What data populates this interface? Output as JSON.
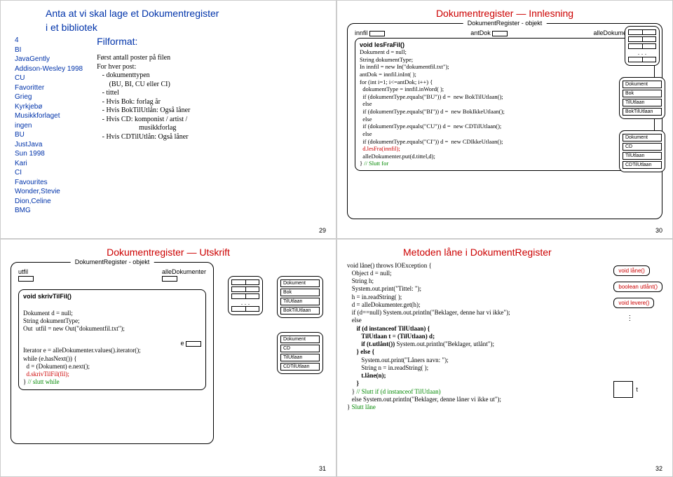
{
  "s29": {
    "title1": "Anta at vi skal lage et Dokumentregister",
    "title2": "i et bibliotek",
    "filformat": "Filformat:",
    "list": [
      "4",
      "BI",
      "JavaGently",
      "Addison-Wesley 1998",
      "CU",
      "Favoritter",
      "Grieg",
      "Kyrkjebø",
      "Musikkforlaget",
      "ingen",
      "BU",
      "JustJava",
      "Sun 1998",
      "Kari",
      "CI",
      "Favourites",
      "Wonder,Stevie",
      "Dion,Celine",
      "BMG"
    ],
    "desc": "Først antall poster på filen\nFor hver post:\n   - dokumenttypen\n       (BU, BI, CU eller CI)\n   - tittel\n   - Hvis Bok: forlag år\n   - Hvis BokTilUtlån: Også låner\n   - Hvis CD: komponist / artist /\n                        musikkforlag\n   - Hvis CDTilUtlån: Også låner",
    "page": "29"
  },
  "s30": {
    "title": "Dokumentregister — Innlesning",
    "obj": "DokumentRegister - objekt",
    "innfil": "innfil",
    "antDok": "antDok",
    "alleDok": "alleDokumenter",
    "method": "void lesFraFil()",
    "code": "Dokument d = null;\nString dokumentType;\nIn innfil = new In(\"dokumentfil.txt\");\nantDok = innfil.inInt( );\nfor (int i=1; i<=antDok; i++) {\n  dokumentType = innfil.inWord( );\n  if (dokumentType.equals(\"BU\")) d =  new BokTilUtlaan();\n  else\n  if (dokumentType.equals(\"BI\")) d =  new BokIkkeUtlaan();\n  else\n  if (dokumentType.equals(\"CU\")) d =  new CDTilUtlaan();\n  else\n  if (dokumentType.equals(\"CI\")) d =  new CDIkkeUtlaan();\n  d.lesFra(innfil);\n  alleDokumenter.put(d.tittel,d);\n} // Slutt for",
    "box1": [
      "Dokument",
      "Bok",
      "TilUtlaan",
      "BokTilUtlaan"
    ],
    "box2": [
      "Dokument",
      "CD",
      "TilUtlaan",
      "CDTilUtlaan"
    ],
    "page": "30"
  },
  "s31": {
    "title": "Dokumentregister — Utskrift",
    "obj": "DokumentRegister - objekt",
    "utfil": "utfil",
    "alleDok": "alleDokumenter",
    "method": "void skrivTilFil()",
    "e": "e",
    "code1": "Dokument d = null;\nString dokumentType;\nOut  utfil = new Out(\"dokumentfil.txt\");",
    "code2": "Iterator e = alleDokumenter.values().iterator();\nwhile (e.hasNext()) {\n  d = (Dokument) e.next();\n  d.skrivTilFil(fil);\n} // slutt while",
    "box1": [
      "Dokument",
      "Bok",
      "TilUtlaan",
      "BokTilUtlaan"
    ],
    "box2": [
      "Dokument",
      "CD",
      "TilUtlaan",
      "CDTilUtlaan"
    ],
    "page": "31"
  },
  "s32": {
    "title": "Metoden låne i DokumentRegister",
    "m1": "void låne()",
    "m2": "boolean utlånt()",
    "m3": "void levere()",
    "t": "t",
    "code": "void låne() throws IOException {\n   Object d = null;\n   String h;\n   System.out.print(\"Tittel: \");\n   h = in.readString( );\n   d = alleDokumenter.get(h);\n   if (d==null) System.out.println(\"Beklager, denne har vi ikke\");\n   else\n      if (d instanceof TilUtlaan) {\n         TilUtlaan t = (TilUtlaan) d;\n         if (t.utlånt()) System.out.println(\"Beklager, utlånt\");\n      } else {\n         System.out.print(\"Låners navn: \");\n         String n = in.readString( );\n         t.låne(n);\n      }\n   } // Slutt if (d instanceof TilUtlaan)\n   else System.out.println(\"Beklager, denne låner vi ikke ut\");\n} Slutt låne",
    "page": "32"
  }
}
